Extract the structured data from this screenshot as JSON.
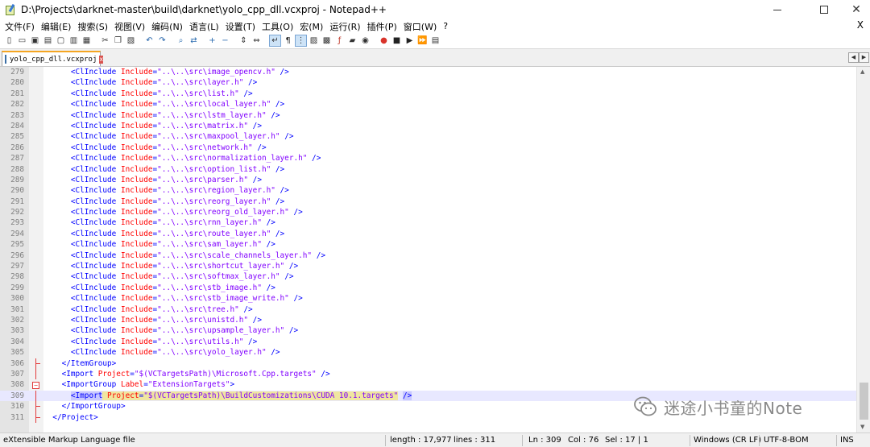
{
  "window": {
    "title": "D:\\Projects\\darknet-master\\build\\darknet\\yolo_cpp_dll.vcxproj - Notepad++"
  },
  "menu": [
    "文件(F)",
    "编辑(E)",
    "搜索(S)",
    "视图(V)",
    "编码(N)",
    "语言(L)",
    "设置(T)",
    "工具(O)",
    "宏(M)",
    "运行(R)",
    "插件(P)",
    "窗口(W)",
    "?"
  ],
  "menu_close": "X",
  "tab": {
    "label": "yolo_cpp_dll.vcxproj",
    "close": "x"
  },
  "editor": {
    "lines": [
      {
        "n": "279",
        "indent": "      ",
        "kind": "inc",
        "path": "..\\..\\src\\image_opencv.h"
      },
      {
        "n": "280",
        "indent": "      ",
        "kind": "inc",
        "path": "..\\..\\src\\layer.h"
      },
      {
        "n": "281",
        "indent": "      ",
        "kind": "inc",
        "path": "..\\..\\src\\list.h"
      },
      {
        "n": "282",
        "indent": "      ",
        "kind": "inc",
        "path": "..\\..\\src\\local_layer.h"
      },
      {
        "n": "283",
        "indent": "      ",
        "kind": "inc",
        "path": "..\\..\\src\\lstm_layer.h"
      },
      {
        "n": "284",
        "indent": "      ",
        "kind": "inc",
        "path": "..\\..\\src\\matrix.h"
      },
      {
        "n": "285",
        "indent": "      ",
        "kind": "inc",
        "path": "..\\..\\src\\maxpool_layer.h"
      },
      {
        "n": "286",
        "indent": "      ",
        "kind": "inc",
        "path": "..\\..\\src\\network.h"
      },
      {
        "n": "287",
        "indent": "      ",
        "kind": "inc",
        "path": "..\\..\\src\\normalization_layer.h"
      },
      {
        "n": "288",
        "indent": "      ",
        "kind": "inc",
        "path": "..\\..\\src\\option_list.h"
      },
      {
        "n": "289",
        "indent": "      ",
        "kind": "inc",
        "path": "..\\..\\src\\parser.h"
      },
      {
        "n": "290",
        "indent": "      ",
        "kind": "inc",
        "path": "..\\..\\src\\region_layer.h"
      },
      {
        "n": "291",
        "indent": "      ",
        "kind": "inc",
        "path": "..\\..\\src\\reorg_layer.h"
      },
      {
        "n": "292",
        "indent": "      ",
        "kind": "inc",
        "path": "..\\..\\src\\reorg_old_layer.h"
      },
      {
        "n": "293",
        "indent": "      ",
        "kind": "inc",
        "path": "..\\..\\src\\rnn_layer.h"
      },
      {
        "n": "294",
        "indent": "      ",
        "kind": "inc",
        "path": "..\\..\\src\\route_layer.h"
      },
      {
        "n": "295",
        "indent": "      ",
        "kind": "inc",
        "path": "..\\..\\src\\sam_layer.h"
      },
      {
        "n": "296",
        "indent": "      ",
        "kind": "inc",
        "path": "..\\..\\src\\scale_channels_layer.h"
      },
      {
        "n": "297",
        "indent": "      ",
        "kind": "inc",
        "path": "..\\..\\src\\shortcut_layer.h"
      },
      {
        "n": "298",
        "indent": "      ",
        "kind": "inc",
        "path": "..\\..\\src\\softmax_layer.h"
      },
      {
        "n": "299",
        "indent": "      ",
        "kind": "inc",
        "path": "..\\..\\src\\stb_image.h"
      },
      {
        "n": "300",
        "indent": "      ",
        "kind": "inc",
        "path": "..\\..\\src\\stb_image_write.h"
      },
      {
        "n": "301",
        "indent": "      ",
        "kind": "inc",
        "path": "..\\..\\src\\tree.h"
      },
      {
        "n": "302",
        "indent": "      ",
        "kind": "inc",
        "path": "..\\..\\src\\unistd.h"
      },
      {
        "n": "303",
        "indent": "      ",
        "kind": "inc",
        "path": "..\\..\\src\\upsample_layer.h"
      },
      {
        "n": "304",
        "indent": "      ",
        "kind": "inc",
        "path": "..\\..\\src\\utils.h"
      },
      {
        "n": "305",
        "indent": "      ",
        "kind": "inc",
        "path": "..\\..\\src\\yolo_layer.h"
      },
      {
        "n": "306",
        "indent": "    ",
        "kind": "close",
        "text": "</ItemGroup>"
      },
      {
        "n": "307",
        "indent": "    ",
        "kind": "import",
        "path": "$(VCTargetsPath)\\Microsoft.Cpp.targets"
      },
      {
        "n": "308",
        "indent": "    ",
        "kind": "igopen",
        "label": "ExtensionTargets"
      },
      {
        "n": "309",
        "indent": "      ",
        "kind": "import_hl",
        "path": "$(VCTargetsPath)\\BuildCustomizations\\CUDA 10.1.targets"
      },
      {
        "n": "310",
        "indent": "    ",
        "kind": "close",
        "text": "</ImportGroup>"
      },
      {
        "n": "311",
        "indent": "  ",
        "kind": "close",
        "text": "</Project>"
      }
    ]
  },
  "watermark": {
    "text": "迷途小书童的Note"
  },
  "status": {
    "type": "eXtensible Markup Language file",
    "length": "length : 17,977",
    "lines": "lines : 311",
    "ln": "Ln : 309",
    "col": "Col : 76",
    "sel": "Sel : 17 | 1",
    "eol": "Windows (CR LF)",
    "encoding": "UTF-8-BOM",
    "mode": "INS"
  },
  "colors": {
    "tag": "#0000ff",
    "attr": "#ff0000",
    "value": "#8000ff",
    "current_line": "#e8e8ff",
    "fold_marker": "#e23b3b"
  },
  "toolbar_icons": [
    "new-file-icon",
    "open-file-icon",
    "save-icon",
    "save-all-icon",
    "close-icon",
    "close-all-icon",
    "print-icon",
    "cut-icon",
    "copy-icon",
    "paste-icon",
    "undo-icon",
    "redo-icon",
    "find-icon",
    "replace-icon",
    "zoom-in-icon",
    "zoom-out-icon",
    "sync-v-icon",
    "sync-h-icon",
    "word-wrap-icon",
    "show-all-chars-icon",
    "indent-guide-icon",
    "udl-icon",
    "doc-map-icon",
    "function-list-icon",
    "folder-as-workspace-icon",
    "monitoring-icon",
    "record-macro-icon",
    "stop-record-icon",
    "play-macro-icon",
    "play-multiple-icon",
    "save-macro-icon"
  ]
}
